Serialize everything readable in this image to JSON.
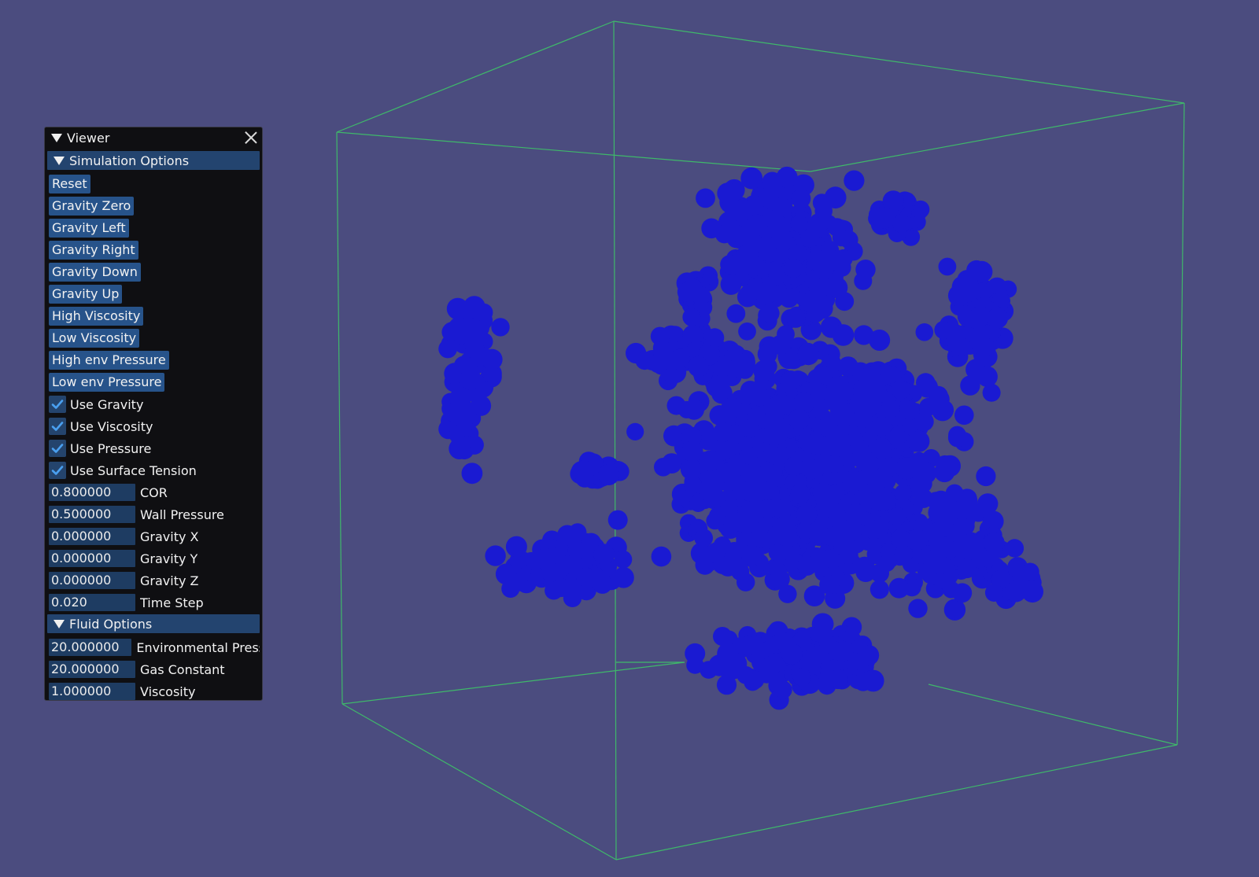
{
  "window": {
    "title": "Viewer",
    "close_icon": "close-icon",
    "collapse_icon": "triangle-down-icon"
  },
  "colors": {
    "background": "#4b4c7f",
    "box_lines": "#3fb86a",
    "particles": "#1a1ad2",
    "header_bg": "#23446f",
    "button_bg": "#27538a"
  },
  "simulation": {
    "header": "Simulation Options",
    "buttons": [
      "Reset",
      "Gravity Zero",
      "Gravity Left",
      "Gravity Right",
      "Gravity Down",
      "Gravity Up",
      "High Viscosity",
      "Low Viscosity",
      "High env Pressure",
      "Low env Pressure"
    ],
    "checkboxes": [
      {
        "label": "Use Gravity",
        "checked": true
      },
      {
        "label": "Use Viscosity",
        "checked": true
      },
      {
        "label": "Use Pressure",
        "checked": true
      },
      {
        "label": "Use Surface Tension",
        "checked": true
      }
    ],
    "fields": [
      {
        "value": "0.800000",
        "label": "COR"
      },
      {
        "value": "0.500000",
        "label": "Wall Pressure"
      },
      {
        "value": "0.000000",
        "label": "Gravity X"
      },
      {
        "value": "0.000000",
        "label": "Gravity Y"
      },
      {
        "value": "0.000000",
        "label": "Gravity Z"
      },
      {
        "value": "0.020",
        "label": "Time Step"
      }
    ]
  },
  "fluid": {
    "header": "Fluid Options",
    "fields": [
      {
        "value": "20.000000",
        "label": "Environmental Press"
      },
      {
        "value": "20.000000",
        "label": "Gas Constant"
      },
      {
        "value": "1.000000",
        "label": "Viscosity"
      }
    ]
  }
}
